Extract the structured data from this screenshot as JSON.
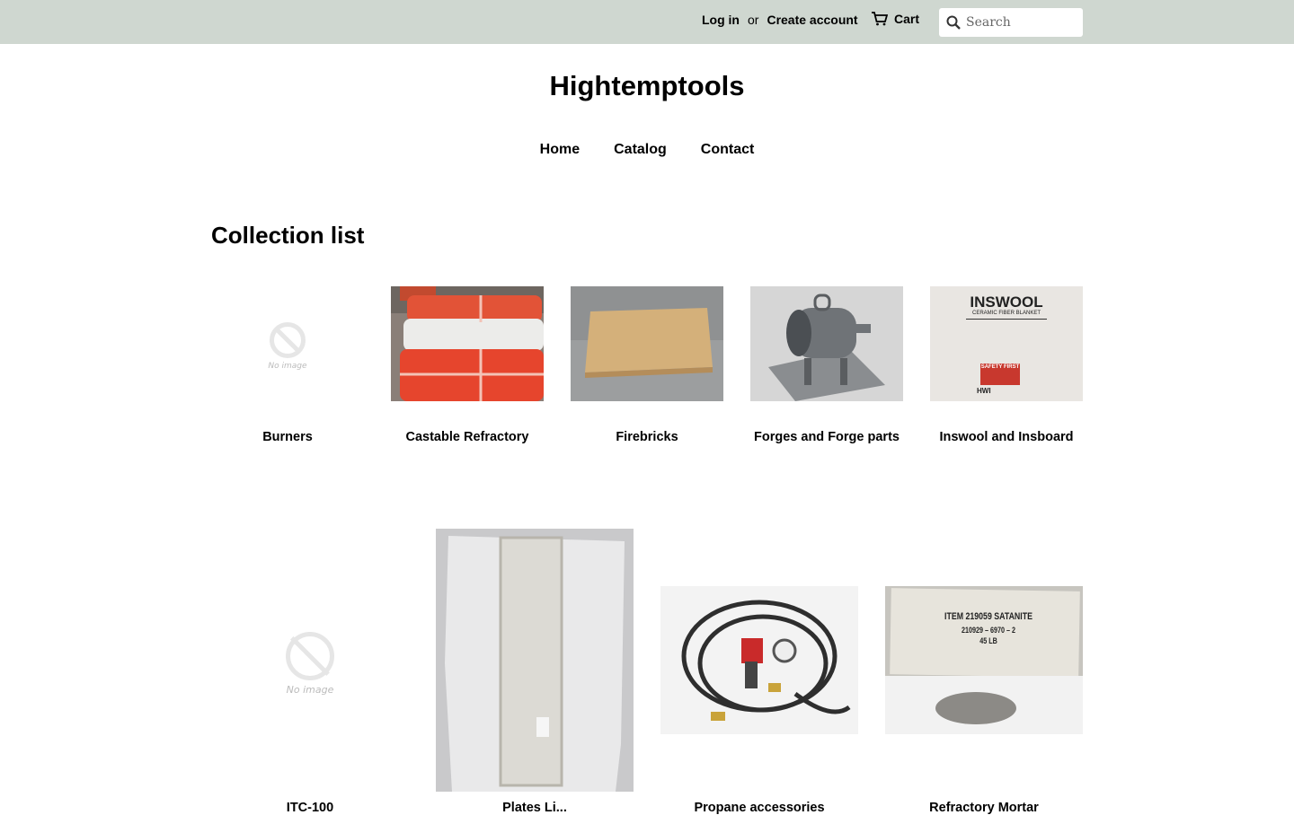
{
  "header": {
    "login": "Log in",
    "or": "or",
    "create_account": "Create account",
    "cart": "Cart",
    "search_placeholder": "Search"
  },
  "site_title": "Hightemptools",
  "nav": [
    "Home",
    "Catalog",
    "Contact"
  ],
  "section_title": "Collection list",
  "collections": [
    {
      "title": "Burners",
      "image": "no-image",
      "placeholder_text": "No image"
    },
    {
      "title": "Castable Refractory",
      "image": "refractory-bags"
    },
    {
      "title": "Firebricks",
      "image": "firebrick"
    },
    {
      "title": "Forges and Forge parts",
      "image": "forge"
    },
    {
      "title": "Inswool and Insboard",
      "image": "inswool-box",
      "image_text": [
        "INSWOOL",
        "CERAMIC FIBER BLANKET",
        "SAFETY FIRST",
        "HWI"
      ]
    },
    {
      "title": "ITC-100",
      "image": "no-image",
      "placeholder_text": "No image"
    },
    {
      "title": "Plates Li...",
      "image": "glass-plate"
    },
    {
      "title": "Propane accessories",
      "image": "propane-hose"
    },
    {
      "title": "Refractory Mortar",
      "image": "mortar-bag",
      "image_text": [
        "ITEM 219059 SATANITE",
        "210929 – 6970 – 2",
        "45 LB"
      ]
    }
  ]
}
